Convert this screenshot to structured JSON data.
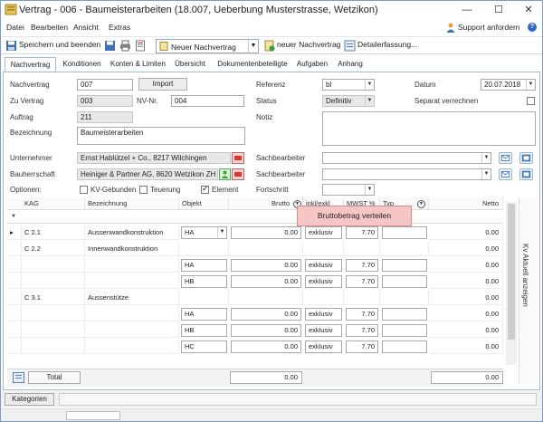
{
  "window": {
    "title": "Vertrag - 006 - Baumeisterarbeiten (18.007, Ueberbung Musterstrasse, Wetzikon)",
    "minimize": "—",
    "maximize": "☐",
    "close": "✕"
  },
  "menu": {
    "items": [
      "Datei",
      "Bearbeiten",
      "Ansicht",
      "Extras"
    ],
    "support": "Support anfordern",
    "help": "?"
  },
  "toolbar": {
    "save_close": "Speichern und beenden",
    "new_combo": "Neuer Nachvertrag",
    "new_button": "neuer Nachvertrag",
    "detail_button": "Detailerfassung..."
  },
  "tabs": [
    "Nachvertrag",
    "Konditionen",
    "Konten & Limiten",
    "Übersicht",
    "Dokumentenbeteiligte",
    "Aufgaben",
    "Anhang"
  ],
  "form": {
    "nachvertrag_label": "Nachvertrag",
    "nachvertrag_value": "007",
    "import_button": "Import",
    "zu_vertrag_label": "Zu Vertrag",
    "zu_vertrag_value": "003",
    "nv_nr_label": "NV-Nr.",
    "nv_nr_value": "004",
    "auftrag_label": "Auftrag",
    "auftrag_value": "211",
    "bezeichnung_label": "Bezeichnung",
    "bezeichnung_value": "Baumeisterarbeiten",
    "referenz_label": "Referenz",
    "referenz_value": "bl",
    "status_label": "Status",
    "status_value": "Definitiv",
    "notiz_label": "Notiz",
    "datum_label": "Datum",
    "datum_value": "20.07.2018",
    "separat_label": "Separat verrechnen",
    "unternehmer_label": "Unternehmer",
    "unternehmer_value": "Ernst Hablützel + Co., 8217 Wilchingen",
    "bauherrschaft_label": "Bauherrschaft",
    "bauherrschaft_value": "Heiniger & Partner AG, 8620 Wetzikon ZH",
    "sachbearbeiter_label": "Sachbearbeiter",
    "sachbearbeiter2_label": "Sachbearbeiter",
    "optionen_label": "Optionen:",
    "kv_gebunden": "KV-Gebunden",
    "teuerung": "Teuerung",
    "element": "Element",
    "fortschritt_label": "Fortschritt"
  },
  "grid": {
    "headers": [
      "KAG",
      "Bezeichnung",
      "Objekt",
      "Brutto",
      "inkl/exkl",
      "MWST %",
      "Typ",
      "Netto",
      "KAG"
    ],
    "filter_icon": "▼",
    "rows": [
      {
        "marker": "▸",
        "kag": "C 2.1",
        "bez": "Aussenwandkonstruktion",
        "obj": "HA",
        "brutto": "0.00",
        "inkl": "exklusiv",
        "mwst": "7.70",
        "typ": "",
        "netto": "0.00"
      },
      {
        "marker": "",
        "kag": "C 2.2",
        "bez": "Innenwandkonstruktion",
        "obj": "",
        "brutto": "",
        "inkl": "",
        "mwst": "",
        "typ": "",
        "netto": "0.00"
      },
      {
        "marker": "",
        "kag": "",
        "bez": "",
        "obj": "HA",
        "brutto": "0.00",
        "inkl": "exklusiv",
        "mwst": "7.70",
        "typ": "",
        "netto": "0.00"
      },
      {
        "marker": "",
        "kag": "",
        "bez": "",
        "obj": "HB",
        "brutto": "0.00",
        "inkl": "exklusiv",
        "mwst": "7.70",
        "typ": "",
        "netto": "0.00"
      },
      {
        "marker": "",
        "kag": "C 3.1",
        "bez": "Aussenstütze",
        "obj": "",
        "brutto": "",
        "inkl": "",
        "mwst": "",
        "typ": "",
        "netto": "0.00"
      },
      {
        "marker": "",
        "kag": "",
        "bez": "",
        "obj": "HA",
        "brutto": "0.00",
        "inkl": "exklusiv",
        "mwst": "7.70",
        "typ": "",
        "netto": "0.00"
      },
      {
        "marker": "",
        "kag": "",
        "bez": "",
        "obj": "HB",
        "brutto": "0.00",
        "inkl": "exklusiv",
        "mwst": "7.70",
        "typ": "",
        "netto": "0.00"
      },
      {
        "marker": "",
        "kag": "",
        "bez": "",
        "obj": "HC",
        "brutto": "0.00",
        "inkl": "exklusiv",
        "mwst": "7.70",
        "typ": "",
        "netto": "0.00"
      }
    ],
    "total_label": "Total",
    "total_brutto": "0.00",
    "total_netto": "0.00",
    "tooltip": "Bruttobetrag verteilen",
    "side_label": "Kv Aktuell anzeigen"
  },
  "statusbar": {
    "kategorien": "Kategorien"
  }
}
